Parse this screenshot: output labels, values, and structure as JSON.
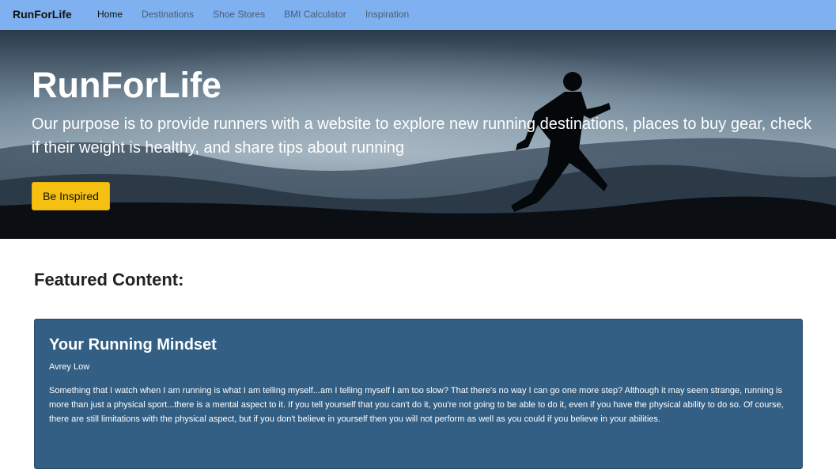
{
  "navbar": {
    "brand": "RunForLife",
    "links": [
      {
        "label": "Home"
      },
      {
        "label": "Destinations"
      },
      {
        "label": "Shoe Stores"
      },
      {
        "label": "BMI Calculator"
      },
      {
        "label": "Inspiration"
      }
    ],
    "active_link": "Home",
    "background_color": "#7fb0ef"
  },
  "hero": {
    "title": "RunForLife",
    "subtitle": "Our purpose is to provide runners with a website to explore new running destinations, places to buy gear, check if their weight is healthy, and share tips about running",
    "button_label": "Be Inspired",
    "button_color": "#f5c012"
  },
  "featured": {
    "heading": "Featured Content:",
    "card": {
      "title": "Your Running Mindset",
      "author": "Avrey Low",
      "body": "Something that I watch when I am running is what I am telling myself...am I telling myself I am too slow? That there's no way I can go one more step? Although it may seem strange, running is more than just a physical sport...there is a mental aspect to it. If you tell yourself that you can't do it, you're not going to be able to do it, even if you have the physical ability to do so. Of course, there are still limitations with the physical aspect, but if you don't believe in yourself then you will not perform as well as you could if you believe in your abilities.",
      "background_color": "#335f84"
    }
  }
}
